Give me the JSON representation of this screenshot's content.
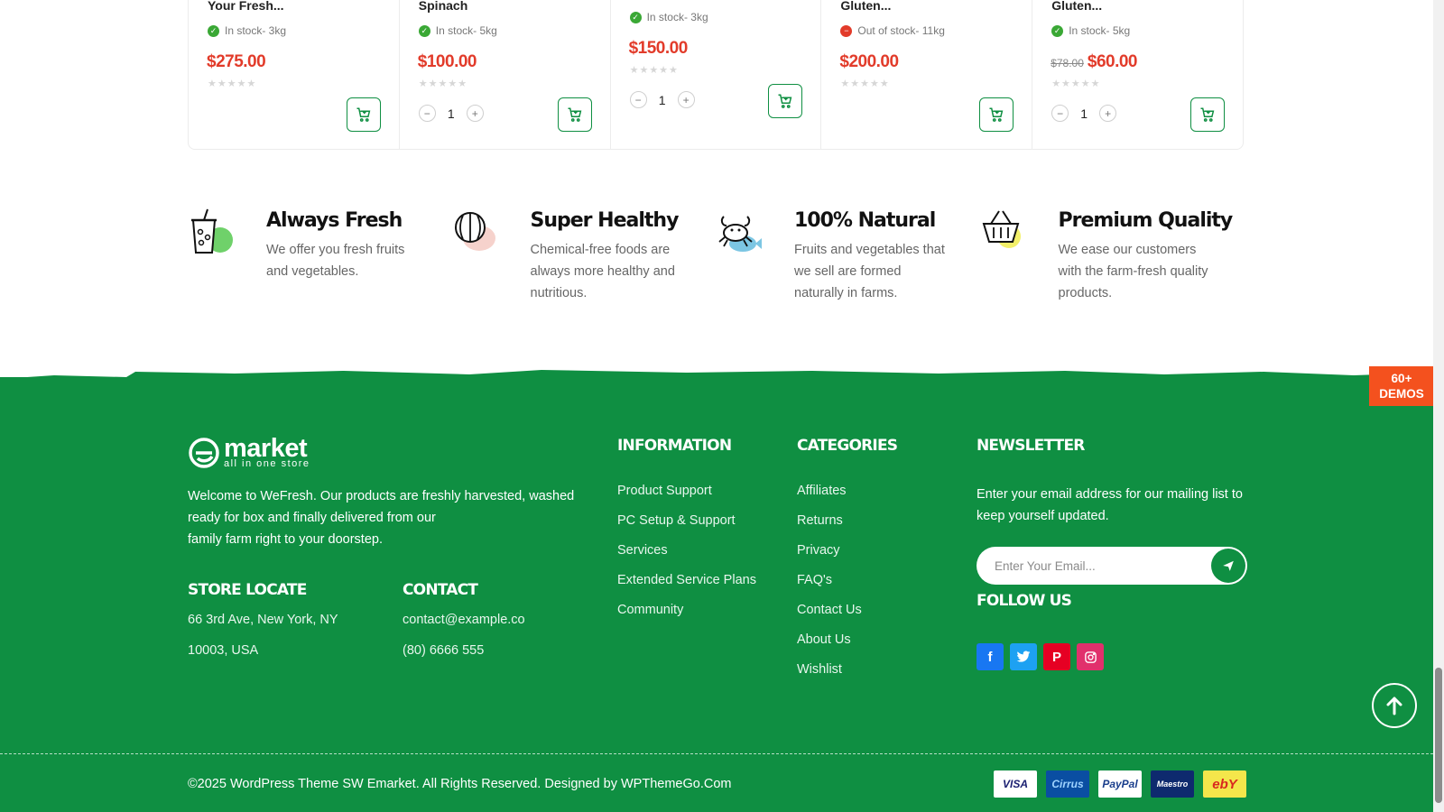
{
  "products": [
    {
      "name": "Your Fresh...",
      "stock": "In stock- 3kg",
      "in_stock": true,
      "price": "$275.00",
      "old_price": "",
      "show_qty": false,
      "qty": ""
    },
    {
      "name": "Spinach",
      "stock": "In stock- 5kg",
      "in_stock": true,
      "price": "$100.00",
      "old_price": "",
      "show_qty": true,
      "qty": "1"
    },
    {
      "name": "",
      "stock": "In stock- 3kg",
      "in_stock": true,
      "price": "$150.00",
      "old_price": "",
      "show_qty": true,
      "qty": "1"
    },
    {
      "name": "Gluten...",
      "stock": "Out of stock- 11kg",
      "in_stock": false,
      "price": "$200.00",
      "old_price": "",
      "show_qty": false,
      "qty": ""
    },
    {
      "name": "Gluten...",
      "stock": "In stock- 5kg",
      "in_stock": true,
      "price": "$60.00",
      "old_price": "$78.00",
      "show_qty": true,
      "qty": "1"
    }
  ],
  "features": [
    {
      "title": "Always Fresh",
      "text": "We offer you fresh fruits and vegetables.",
      "icon": "juice-cup-icon",
      "accent": "#6fd16a"
    },
    {
      "title": "Super Healthy",
      "text": "Chemical-free foods are always more healthy and nutritious.",
      "icon": "watermelon-icon",
      "accent": "#f6c7c0"
    },
    {
      "title": "100% Natural",
      "text": "Fruits and vegetables that we sell are formed naturally in farms.",
      "icon": "crab-fish-icon",
      "accent": "#7cc6e3"
    },
    {
      "title": "Premium Quality",
      "text": "We ease our customers with the farm-fresh quality products.",
      "icon": "basket-icon",
      "accent": "#f3f06a"
    }
  ],
  "footer": {
    "logo_word": "market",
    "logo_tagline": "all in one store",
    "about_lines": [
      "Welcome to WeFresh. Our products are freshly harvested, washed",
      "ready for box and finally delivered from our",
      "family farm right to your doorstep."
    ],
    "store_title": "STORE LOCATE",
    "store_line1": "66 3rd Ave, New York, NY",
    "store_line2": "10003, USA",
    "contact_title": "CONTACT",
    "contact_email": "contact@example.co",
    "contact_phone": "(80) 6666 555",
    "info_title": "INFORMATION",
    "info_links": [
      "Product Support",
      "PC Setup & Support",
      "Services",
      "Extended Service Plans",
      "Community"
    ],
    "cat_title": "CATEGORIES",
    "cat_links": [
      "Affiliates",
      "Returns",
      "Privacy",
      "FAQ's",
      "Contact Us",
      "About Us",
      "Wishlist"
    ],
    "news_title": "NEWSLETTER",
    "news_text": "Enter your email address for our mailing list to keep yourself updated.",
    "email_placeholder": "Enter Your Email...",
    "follow_title": "FOLLOW US",
    "socials": [
      {
        "name": "facebook-icon",
        "glyph": "f",
        "color": "#1877f2"
      },
      {
        "name": "twitter-icon",
        "glyph": "t",
        "color": "#1da1f2"
      },
      {
        "name": "pinterest-icon",
        "glyph": "p",
        "color": "#e60023"
      },
      {
        "name": "instagram-icon",
        "glyph": "ig",
        "color": "#e1306c"
      }
    ],
    "copyright": "©2025 WordPress Theme SW Emarket. All Rights Reserved. Designed by WPThemeGo.Com",
    "payments": [
      {
        "label": "VISA",
        "bg": "#ffffff",
        "fg": "#1a1f71"
      },
      {
        "label": "Cirrus",
        "bg": "#0a4ea2",
        "fg": "#9fd3ff"
      },
      {
        "label": "PayPal",
        "bg": "#ffffff",
        "fg": "#1a3e8c"
      },
      {
        "label": "Maestro",
        "bg": "#0e2a6e",
        "fg": "#ffffff"
      },
      {
        "label": "ebY",
        "bg": "#f4e64b",
        "fg": "#d9281f"
      }
    ]
  },
  "demos_badge": {
    "line1": "60+",
    "line2": "DEMOS"
  },
  "colors": {
    "brand_green": "#0f8f42",
    "price_red": "#e23b2a",
    "demos_orange": "#f4511e"
  }
}
